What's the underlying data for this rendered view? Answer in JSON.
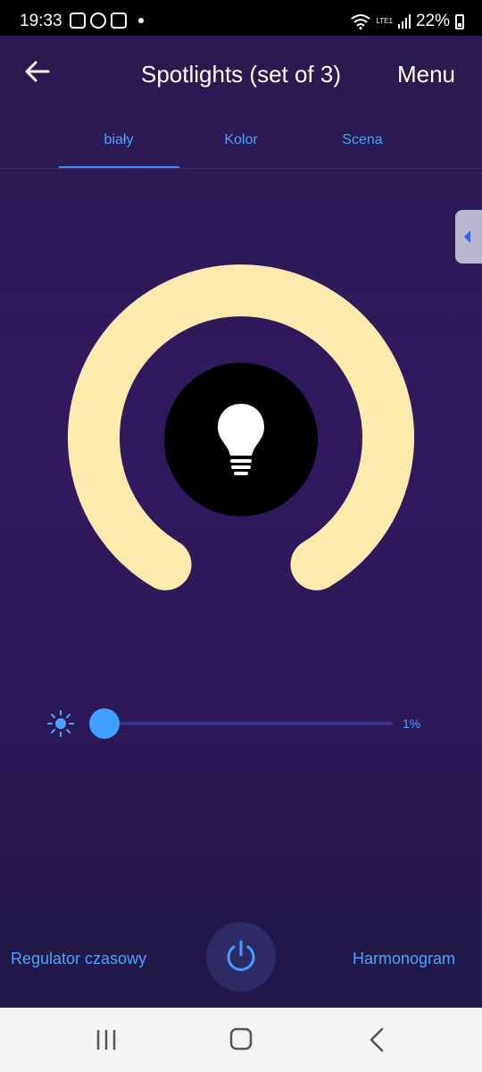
{
  "status_bar": {
    "time": "19:33",
    "network_label": "LTE1",
    "battery": "22%"
  },
  "header": {
    "title": "Spotlights (set of 3)",
    "menu_label": "Menu"
  },
  "tabs": [
    {
      "label": "biały",
      "active": true
    },
    {
      "label": "Kolor",
      "active": false
    },
    {
      "label": "Scena",
      "active": false
    }
  ],
  "dial": {
    "ring_color": "#ffeaad",
    "bulb_icon": "lightbulb-icon"
  },
  "brightness": {
    "value_label": "1%",
    "value": 0.01
  },
  "bottom_bar": {
    "timer_label": "Regulator czasowy",
    "schedule_label": "Harmonogram"
  },
  "colors": {
    "accent": "#4aa3ff",
    "background": "#2d1959",
    "ring": "#ffeaad"
  }
}
